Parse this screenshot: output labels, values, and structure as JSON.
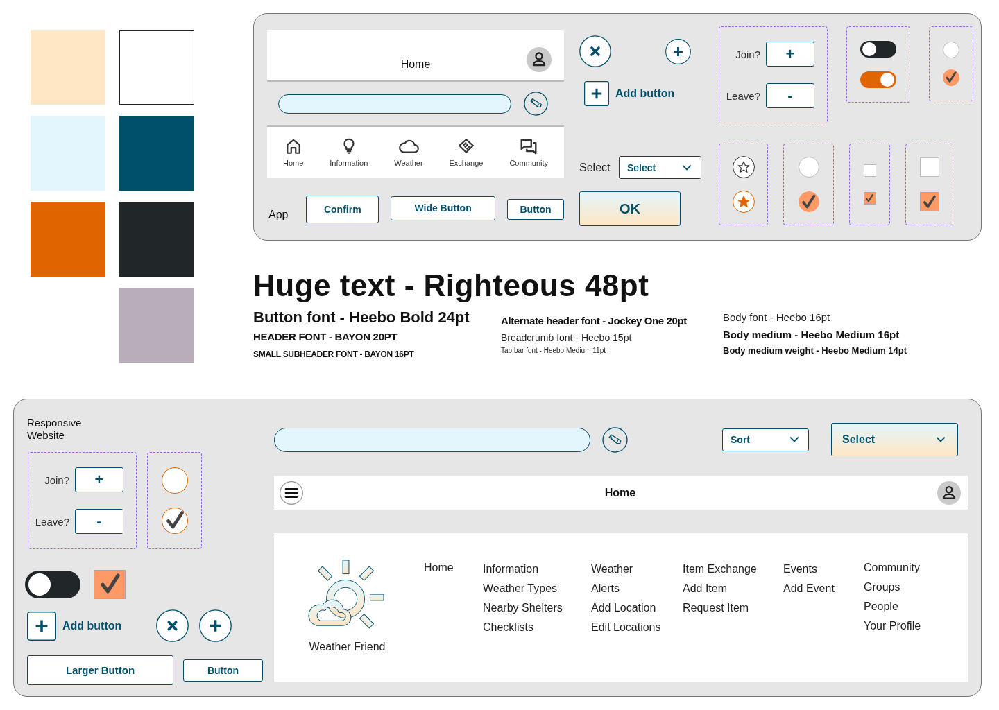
{
  "palette": {
    "columns": [
      {
        "swatches": [
          {
            "color": "#ffe6c4"
          },
          {
            "color": "#e3f6fd"
          },
          {
            "color": "#e06500"
          }
        ]
      },
      {
        "swatches": [
          {
            "color": "#ffffff"
          },
          {
            "color": "#00506b"
          },
          {
            "color": "#212629"
          },
          {
            "color": "#b8adb8"
          }
        ]
      }
    ]
  },
  "app_panel": {
    "header": {
      "title": "Home"
    },
    "tabs": [
      {
        "kind": "home",
        "label": "Home"
      },
      {
        "kind": "information",
        "label": "Information"
      },
      {
        "kind": "weather",
        "label": "Weather"
      },
      {
        "kind": "exchange",
        "label": "Exchange"
      },
      {
        "kind": "community",
        "label": "Community"
      }
    ],
    "label": "App",
    "buttons": [
      "Confirm",
      "Wide Button",
      "Button"
    ],
    "add_button": {
      "label": "Add button"
    },
    "select": {
      "label": "Select",
      "value": "Select"
    },
    "ok_button": "OK",
    "join_leave": {
      "join_label": "Join?",
      "join_button": "+",
      "leave_label": "Leave?",
      "leave_button": "-"
    },
    "toggles": [
      {
        "on": false
      },
      {
        "on": true
      }
    ],
    "choice_groups": [
      {
        "kind": "radio_small",
        "items": [
          {
            "checked": false
          },
          {
            "checked": true
          }
        ]
      },
      {
        "kind": "star",
        "items": [
          {
            "checked": false
          },
          {
            "checked": true
          }
        ]
      },
      {
        "kind": "radio",
        "items": [
          {
            "checked": false
          },
          {
            "checked": true
          }
        ]
      },
      {
        "kind": "checkbox_small",
        "items": [
          {
            "checked": false
          },
          {
            "checked": true
          }
        ]
      },
      {
        "kind": "checkbox",
        "items": [
          {
            "checked": false
          },
          {
            "checked": true
          }
        ]
      }
    ]
  },
  "typography": {
    "title": "Huge text - Righteous 48pt",
    "columns": [
      {
        "samples": [
          {
            "kind": "button",
            "text": "Button font - Heebo Bold 24pt"
          },
          {
            "kind": "header",
            "text": "HEADER FONT - BAYON 20PT"
          },
          {
            "kind": "subheader",
            "text": "SMALL SUBHEADER FONT - BAYON 16PT"
          }
        ]
      },
      {
        "samples": [
          {
            "kind": "alt_header",
            "text": "Alternate header font - Jockey One 20pt"
          },
          {
            "kind": "breadcrumb",
            "text": "Breadcrumb font - Heebo 15pt"
          },
          {
            "kind": "tab_bar",
            "text": "Tab bar font - Heebo Medium 11pt"
          }
        ]
      },
      {
        "samples": [
          {
            "kind": "body",
            "text": "Body font - Heebo 16pt"
          },
          {
            "kind": "body_medium",
            "text": "Body medium - Heebo Medium 16pt"
          },
          {
            "kind": "body_medium_small",
            "text": "Body medium weight - Heebo Medium 14pt"
          }
        ]
      }
    ]
  },
  "website_panel": {
    "title": "Responsive Website",
    "join_leave": {
      "join_label": "Join?",
      "join_button": "+",
      "leave_label": "Leave?",
      "leave_button": "-"
    },
    "radios": [
      {
        "checked": false
      },
      {
        "checked": true
      }
    ],
    "toggle": {
      "on": false
    },
    "checkbox": {
      "checked": true
    },
    "add_button": {
      "label": "Add button"
    },
    "buttons": [
      "Larger Button",
      "Button"
    ],
    "sort": {
      "value": "Sort"
    },
    "select": {
      "value": "Select"
    },
    "header": {
      "title": "Home"
    },
    "footer": {
      "brand": "Weather Friend",
      "nav": [
        {
          "links": [
            "Home"
          ]
        },
        {
          "links": [
            "Information",
            "Weather Types",
            "Nearby Shelters",
            "Checklists"
          ]
        },
        {
          "links": [
            "Weather",
            "Alerts",
            "Add Location",
            "Edit Locations"
          ]
        },
        {
          "links": [
            "Item Exchange",
            "Add Item",
            "Request Item"
          ]
        },
        {
          "links": [
            "Events",
            "Add Event"
          ]
        },
        {
          "links": [
            "Community",
            "Groups",
            "People",
            "Your Profile"
          ]
        }
      ]
    }
  }
}
